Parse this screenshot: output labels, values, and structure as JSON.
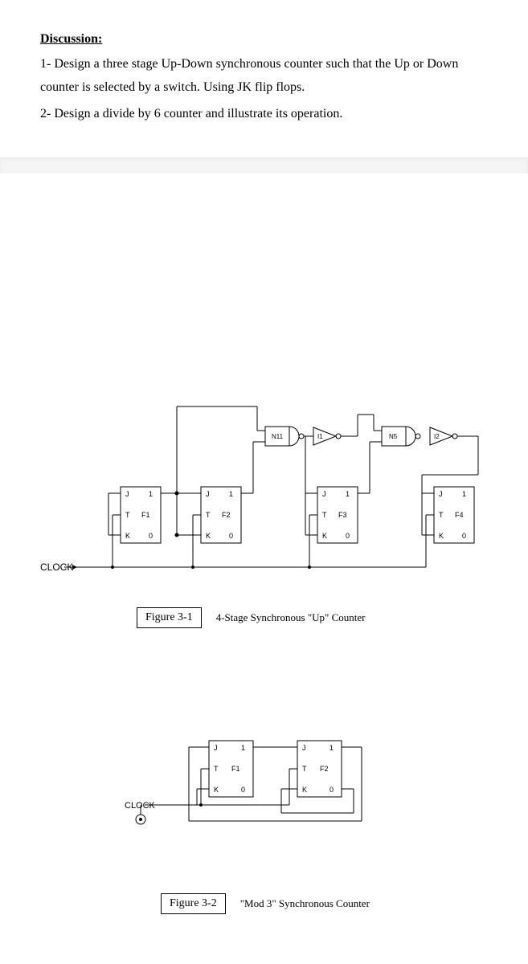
{
  "discussion": {
    "heading": "Discussion:",
    "q1": "1- Design a three stage Up-Down synchronous counter such that the Up or Down counter is selected by a switch. Using JK flip flops.",
    "q2": "2- Design a divide by 6 counter and illustrate its operation."
  },
  "figure1": {
    "label": "Figure 3-1",
    "caption": "4-Stage Synchronous \"Up\" Counter",
    "clock": "CLOCK",
    "gates": {
      "n11": "N11",
      "i1": "I1",
      "n5": "N5",
      "i2": "I2"
    },
    "ff": {
      "j": "J",
      "k": "K",
      "t": "T",
      "one": "1",
      "zero": "0",
      "f1": "F1",
      "f2": "F2",
      "f3": "F3",
      "f4": "F4"
    }
  },
  "figure2": {
    "label": "Figure 3-2",
    "caption": "\"Mod 3\" Synchronous Counter",
    "clock": "CLOCK",
    "ff": {
      "j": "J",
      "k": "K",
      "t": "T",
      "one": "1",
      "zero": "0",
      "f1": "F1",
      "f2": "F2"
    }
  }
}
